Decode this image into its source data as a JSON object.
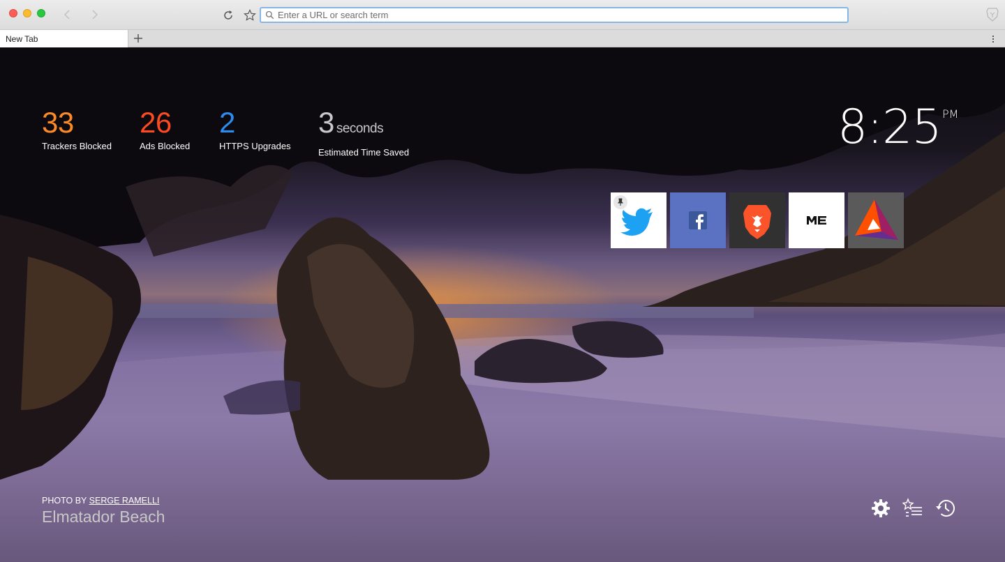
{
  "address_bar": {
    "placeholder": "Enter a URL or search term",
    "value": ""
  },
  "tabs": [
    {
      "label": "New Tab",
      "active": true
    }
  ],
  "stats": {
    "trackers": {
      "value": "33",
      "label": "Trackers Blocked",
      "color": "#fd8a26"
    },
    "ads": {
      "value": "26",
      "label": "Ads Blocked",
      "color": "#fd4a21"
    },
    "https": {
      "value": "2",
      "label": "HTTPS Upgrades",
      "color": "#2d8cf0"
    },
    "time_saved": {
      "value": "3",
      "unit": "seconds",
      "label": "Estimated Time Saved"
    }
  },
  "clock": {
    "time": "8:25",
    "ampm": "PM"
  },
  "top_sites": [
    {
      "name": "twitter",
      "icon": "twitter-bird-icon",
      "pinned": true
    },
    {
      "name": "facebook",
      "icon": "facebook-f-icon",
      "pinned": false
    },
    {
      "name": "brave",
      "icon": "brave-lion-icon",
      "pinned": false
    },
    {
      "name": "medium",
      "icon": "medium-logo-icon",
      "pinned": false
    },
    {
      "name": "bat",
      "icon": "bat-triangle-icon",
      "pinned": false
    }
  ],
  "photo_credit": {
    "prefix": "PHOTO BY",
    "author": "SERGE RAMELLI",
    "location": "Elmatador Beach"
  },
  "bottom_controls": [
    "settings-gear-icon",
    "bookmarks-manager-icon",
    "history-clock-icon"
  ]
}
